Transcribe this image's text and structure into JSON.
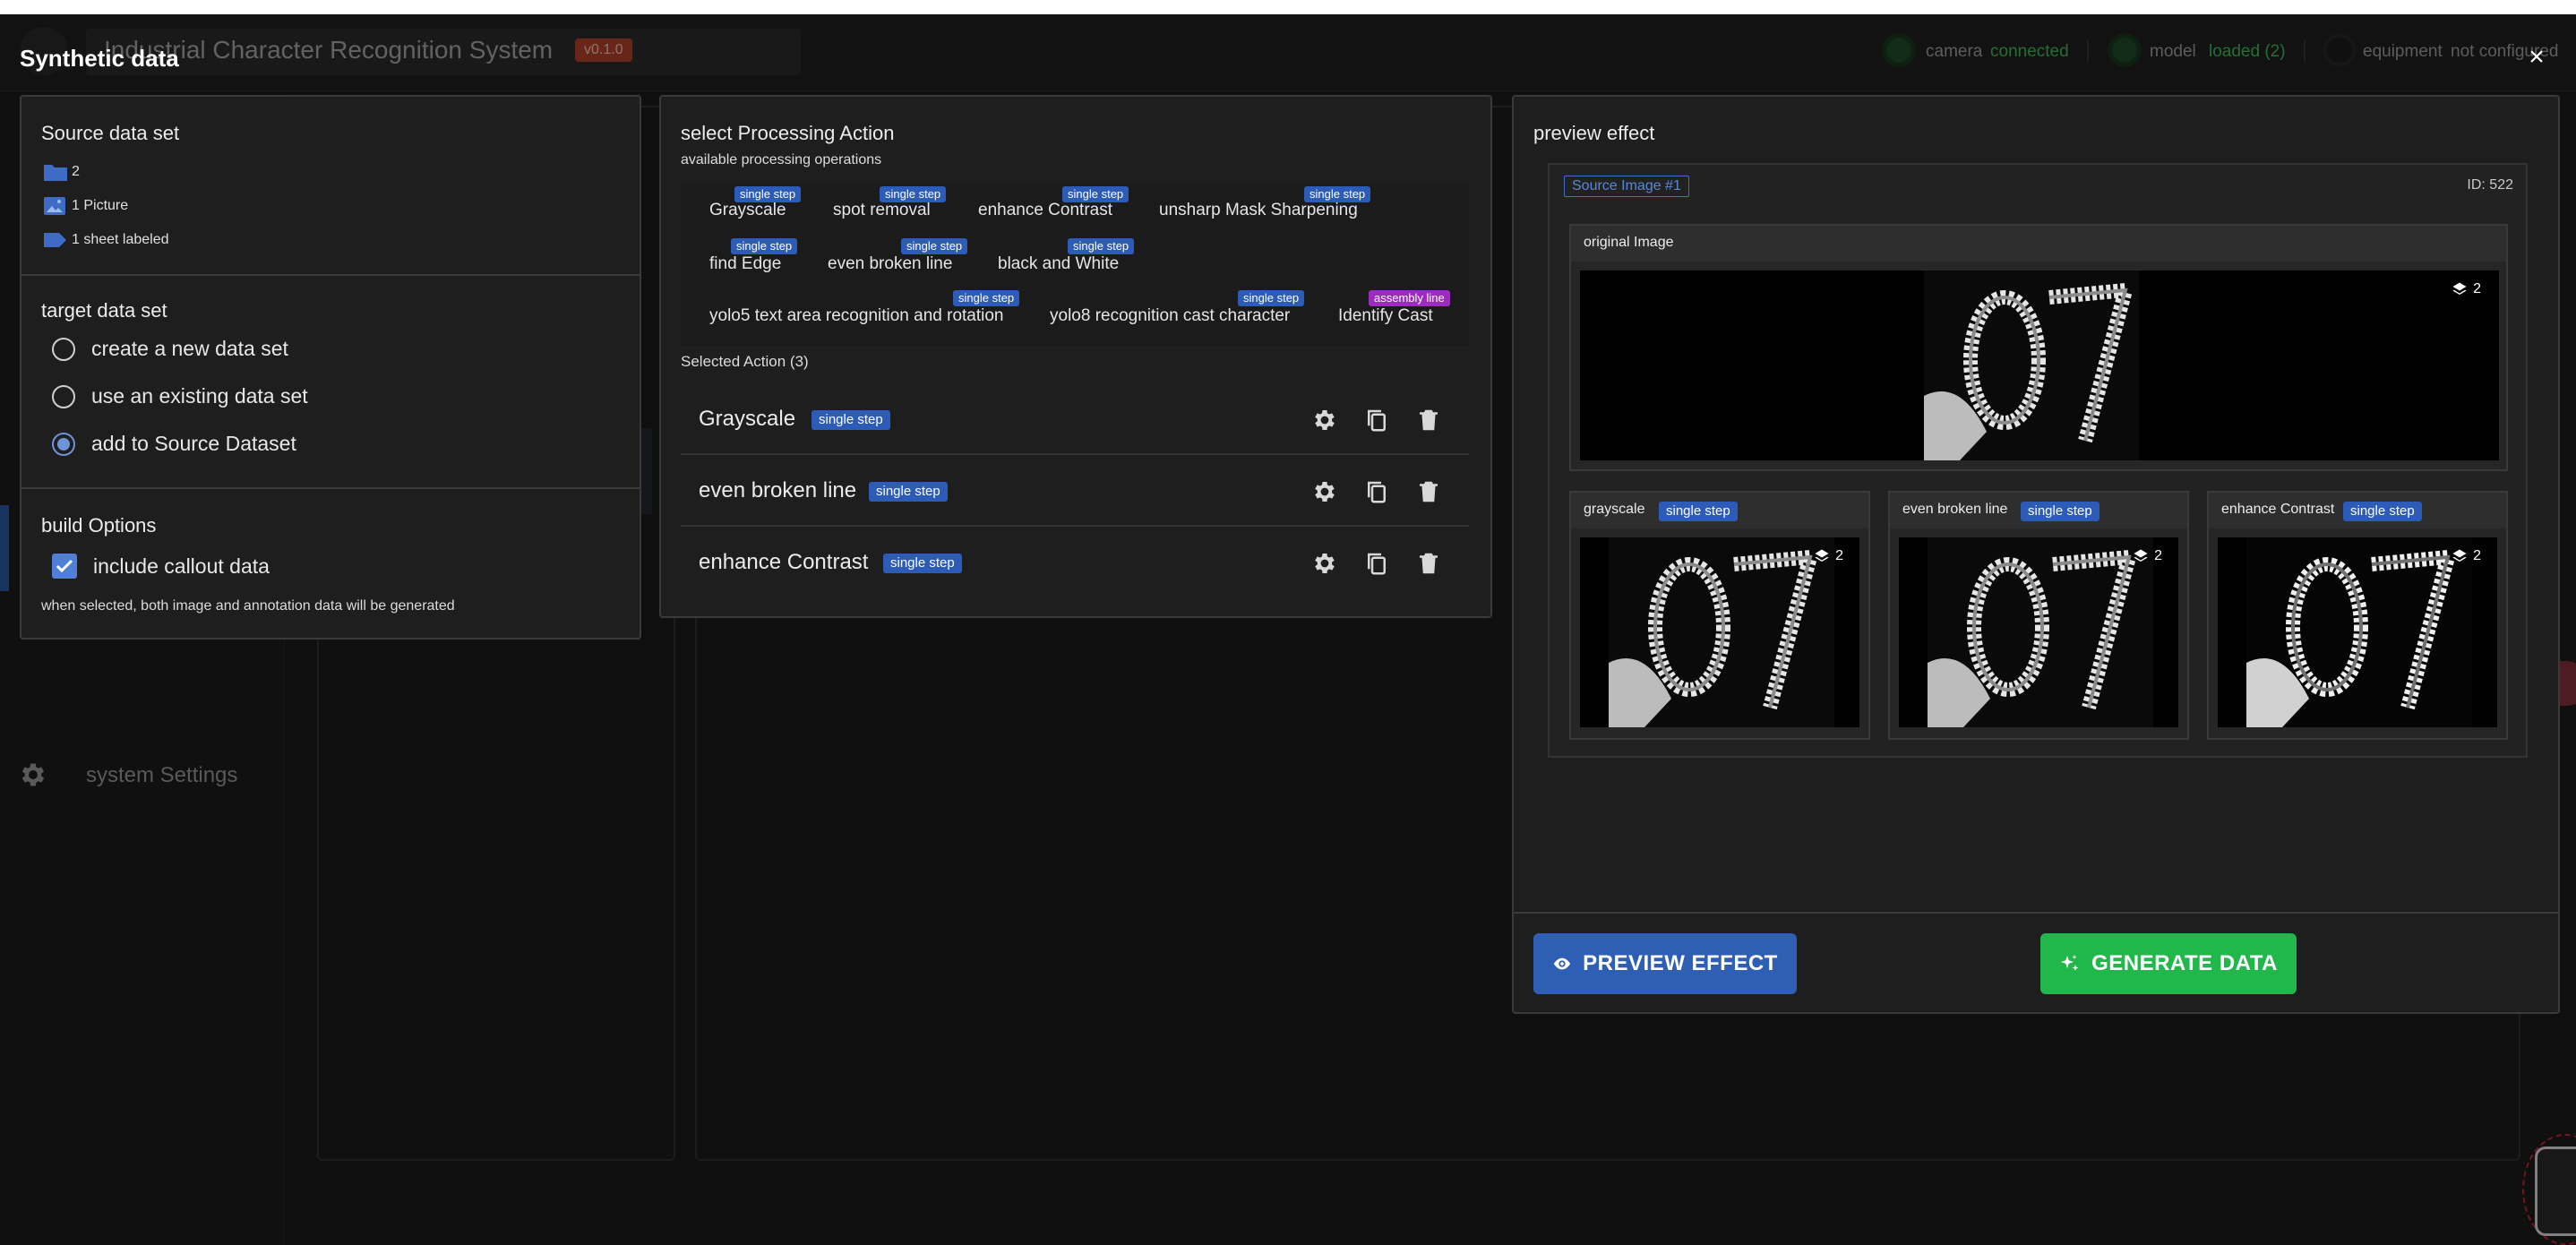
{
  "app": {
    "title": "Industrial Character Recognition System",
    "version": "v0.1.0",
    "status": {
      "camera_label": "camera",
      "camera_value": "connected",
      "model_label": "model",
      "model_value": "loaded (2)",
      "equipment_label": "equipment",
      "equipment_value": "not configured"
    },
    "sidebar": {
      "settings_label": "system Settings"
    }
  },
  "dialog": {
    "title": "Synthetic data",
    "close_label": "×"
  },
  "source": {
    "title": "Source data set",
    "folder_count": "2",
    "pictures": "1 Picture",
    "labeled": "1 sheet labeled"
  },
  "target": {
    "title": "target data set",
    "options": [
      {
        "label": "create a new data set",
        "checked": false
      },
      {
        "label": "use an existing data set",
        "checked": false
      },
      {
        "label": "add to Source Dataset",
        "checked": true
      }
    ]
  },
  "build": {
    "title": "build Options",
    "include_callout_label": "include callout data",
    "include_callout_checked": true,
    "hint": "when selected, both image and annotation data will be generated"
  },
  "processing": {
    "title": "select Processing Action",
    "subtitle": "available processing operations",
    "operations": [
      {
        "label": "Grayscale",
        "tag": "single step"
      },
      {
        "label": "spot removal",
        "tag": "single step"
      },
      {
        "label": "enhance Contrast",
        "tag": "single step"
      },
      {
        "label": "unsharp Mask Sharpening",
        "tag": "single step"
      },
      {
        "label": "find Edge",
        "tag": "single step"
      },
      {
        "label": "even broken line",
        "tag": "single step"
      },
      {
        "label": "black and White",
        "tag": "single step"
      },
      {
        "label": "yolo5 text area recognition and rotation",
        "tag": "single step"
      },
      {
        "label": "yolo8 recognition cast character",
        "tag": "single step"
      },
      {
        "label": "Identify Cast",
        "tag": "assembly line"
      }
    ],
    "selected_title": "Selected Action (3)",
    "selected": [
      {
        "label": "Grayscale",
        "tag": "single step"
      },
      {
        "label": "even broken line",
        "tag": "single step"
      },
      {
        "label": "enhance Contrast",
        "tag": "single step"
      }
    ]
  },
  "preview": {
    "title": "preview effect",
    "source_tag": "Source Image #1",
    "image_id": "ID: 522",
    "original_title": "original Image",
    "original_layers": "2",
    "results": [
      {
        "title": "grayscale",
        "tag": "single step",
        "layers": "2"
      },
      {
        "title": "even broken line",
        "tag": "single step",
        "layers": "2"
      },
      {
        "title": "enhance Contrast",
        "tag": "single step",
        "layers": "2"
      }
    ],
    "preview_button": "PREVIEW EFFECT",
    "generate_button": "GENERATE DATA"
  },
  "colors": {
    "accent_blue": "#2f5fb5",
    "success_green": "#22b74a",
    "tag_blue": "#2c5bb8",
    "tag_purple": "#9b2cbd",
    "status_green": "#3fbf5a",
    "version_orange": "#b5432a"
  }
}
